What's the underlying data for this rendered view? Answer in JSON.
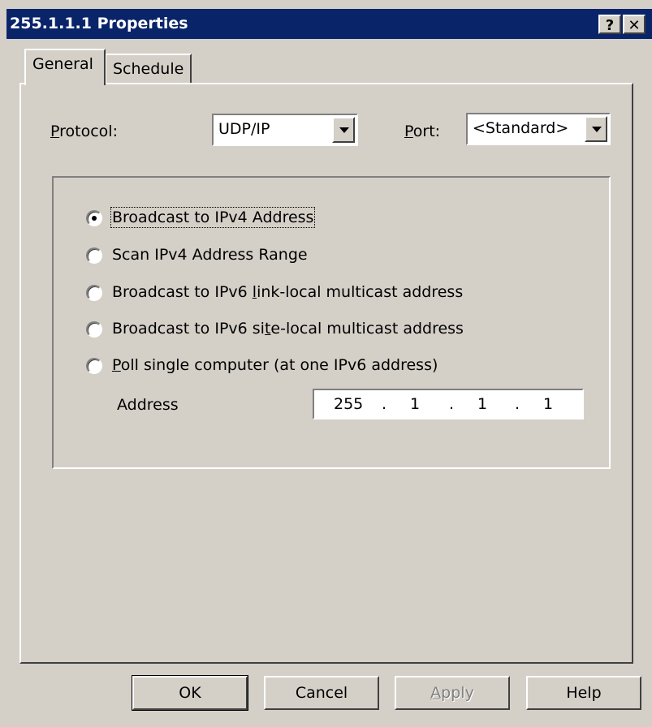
{
  "window": {
    "title": "255.1.1.1 Properties",
    "help_button": "?",
    "close_button": "✕"
  },
  "tabs": [
    {
      "label": "General"
    },
    {
      "label": "Schedule"
    }
  ],
  "protocol": {
    "label_first": "P",
    "label_rest": "rotocol:",
    "value": "UDP/IP"
  },
  "port": {
    "label_first": "P",
    "label_rest": "ort:",
    "value": "<Standard>"
  },
  "options": [
    {
      "label": "Broadcast to IPv4 Address",
      "checked": true
    },
    {
      "label": "Scan IPv4 Address Range",
      "checked": false
    },
    {
      "label_pre": "Broadcast to IPv6 ",
      "label_u": "l",
      "label_post": "ink-local multicast address",
      "checked": false
    },
    {
      "label_pre": "Broadcast to IPv6 si",
      "label_u": "t",
      "label_post": "e-local multicast address",
      "checked": false
    },
    {
      "label_pre": "",
      "label_u": "P",
      "label_post": "oll single computer (at one IPv6 address)",
      "checked": false
    }
  ],
  "address": {
    "label": "Address",
    "octets": [
      "255",
      "1",
      "1",
      "1"
    ],
    "dot": "."
  },
  "buttons": {
    "ok": "OK",
    "cancel": "Cancel",
    "apply_first": "A",
    "apply_rest": "pply",
    "help": "Help"
  }
}
